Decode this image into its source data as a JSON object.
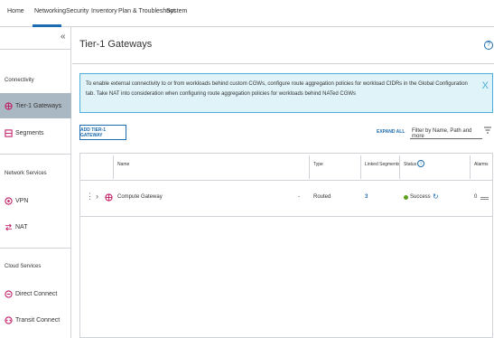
{
  "topnav": {
    "tabs": [
      {
        "label": "Home"
      },
      {
        "label": "Networking"
      },
      {
        "label": "Security"
      },
      {
        "label": "Inventory"
      },
      {
        "label": "Plan & Troubleshoot"
      },
      {
        "label": "System"
      }
    ],
    "active_tab": "Networking"
  },
  "sidebar": {
    "sections": [
      {
        "title": "Connectivity",
        "items": [
          {
            "label": "Tier-1 Gateways",
            "icon": "gateway-icon"
          },
          {
            "label": "Segments",
            "icon": "segments-icon"
          }
        ]
      },
      {
        "title": "Network Services",
        "items": [
          {
            "label": "VPN",
            "icon": "vpn-icon"
          },
          {
            "label": "NAT",
            "icon": "nat-icon"
          }
        ]
      },
      {
        "title": "Cloud Services",
        "items": [
          {
            "label": "Direct Connect",
            "icon": "direct-connect-icon"
          },
          {
            "label": "Transit Connect",
            "icon": "transit-connect-icon"
          }
        ]
      }
    ],
    "active_item": "Tier-1 Gateways"
  },
  "main": {
    "title": "Tier-1 Gateways",
    "help": "?",
    "banner": {
      "text": "To enable external connectivity to or from workloads behind custom CGWs, configure route aggregation policies for workload CIDRs in the Global Configuration tab. Take NAT into consideration when configuring route aggregation policies for workloads behind NATed CGWs",
      "close": "X"
    },
    "toolbar": {
      "add_label": "ADD TIER-1 GATEWAY",
      "expand_label": "EXPAND ALL",
      "filter_placeholder": "Filter by Name, Path and more"
    },
    "grid": {
      "columns": [
        "Name",
        "Type",
        "Linked Segments",
        "Status",
        "Alarms"
      ],
      "rows": [
        {
          "name": "Compute Gateway",
          "dash": "-",
          "type": "Routed",
          "linked_segments": "3",
          "status": "Success",
          "alarms": "0"
        }
      ]
    }
  },
  "colors": {
    "accent": "#1b6bb0",
    "success": "#5e9f1e",
    "gateway_icon": "#c21d67",
    "banner_bg": "#e0f3f9",
    "active_item_bg": "#aab8c4"
  }
}
